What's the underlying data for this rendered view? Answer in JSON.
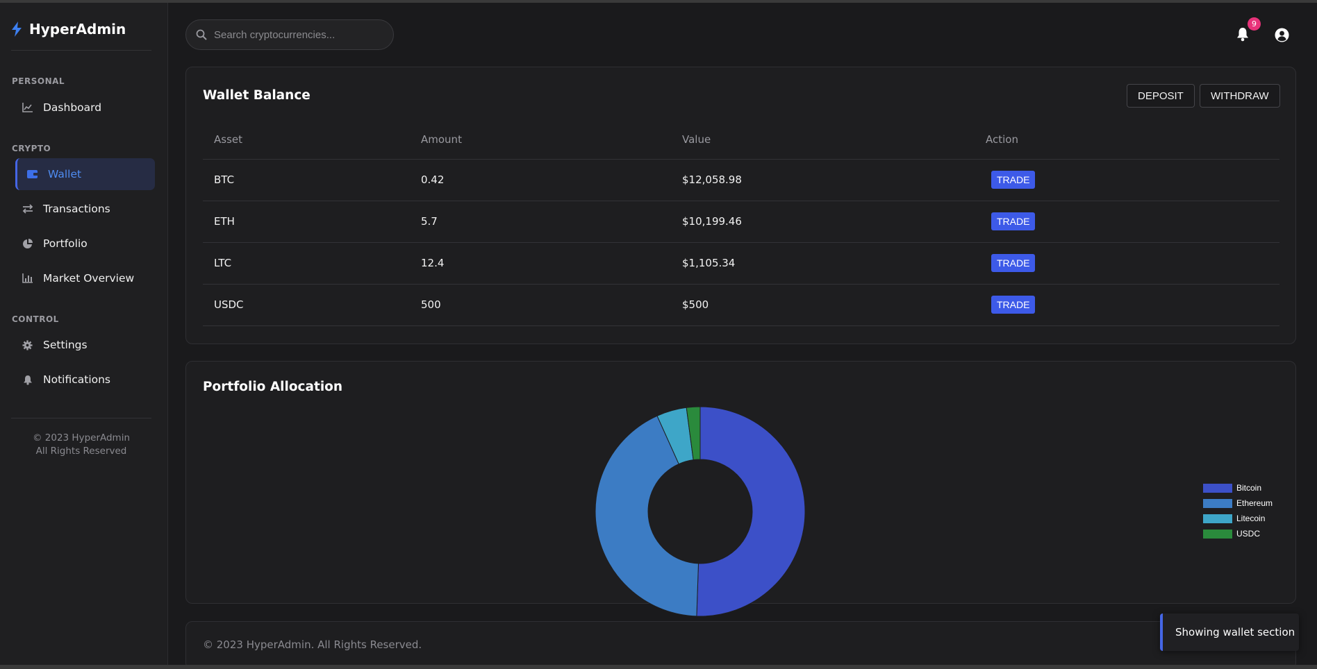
{
  "brand": {
    "name": "HyperAdmin",
    "icon": "bolt-icon"
  },
  "sidebar": {
    "sections": [
      {
        "label": "PERSONAL",
        "items": [
          {
            "label": "Dashboard",
            "icon": "chart-line-icon"
          }
        ]
      },
      {
        "label": "CRYPTO",
        "items": [
          {
            "label": "Wallet",
            "icon": "wallet-icon",
            "active": true
          },
          {
            "label": "Transactions",
            "icon": "exchange-icon"
          },
          {
            "label": "Portfolio",
            "icon": "pie-chart-icon"
          },
          {
            "label": "Market Overview",
            "icon": "bar-chart-icon"
          }
        ]
      },
      {
        "label": "CONTROL",
        "items": [
          {
            "label": "Settings",
            "icon": "gear-icon"
          },
          {
            "label": "Notifications",
            "icon": "bell-icon"
          }
        ]
      }
    ],
    "footer_line1": "© 2023 HyperAdmin",
    "footer_line2": "All Rights Reserved"
  },
  "search": {
    "placeholder": "Search cryptocurrencies...",
    "value": ""
  },
  "header": {
    "notification_count": "9"
  },
  "wallet": {
    "title": "Wallet Balance",
    "deposit_label": "DEPOSIT",
    "withdraw_label": "WITHDRAW",
    "columns": [
      "Asset",
      "Amount",
      "Value",
      "Action"
    ],
    "rows": [
      {
        "asset": "BTC",
        "amount": "0.42",
        "value": "$12,058.98",
        "action": "TRADE"
      },
      {
        "asset": "ETH",
        "amount": "5.7",
        "value": "$10,199.46",
        "action": "TRADE"
      },
      {
        "asset": "LTC",
        "amount": "12.4",
        "value": "$1,105.34",
        "action": "TRADE"
      },
      {
        "asset": "USDC",
        "amount": "500",
        "value": "$500",
        "action": "TRADE"
      }
    ]
  },
  "portfolio": {
    "title": "Portfolio Allocation"
  },
  "chart_data": {
    "type": "pie",
    "title": "",
    "categories": [
      "Bitcoin",
      "Ethereum",
      "Litecoin",
      "USDC"
    ],
    "values": [
      12058.98,
      10199.46,
      1105.34,
      500
    ],
    "colors": [
      "#3c50c8",
      "#3c7cc4",
      "#3ea6c8",
      "#2a8a3c"
    ],
    "legend_position": "right"
  },
  "footer": {
    "text": "© 2023 HyperAdmin. All Rights Reserved."
  },
  "toast": {
    "text": "Showing wallet section"
  }
}
